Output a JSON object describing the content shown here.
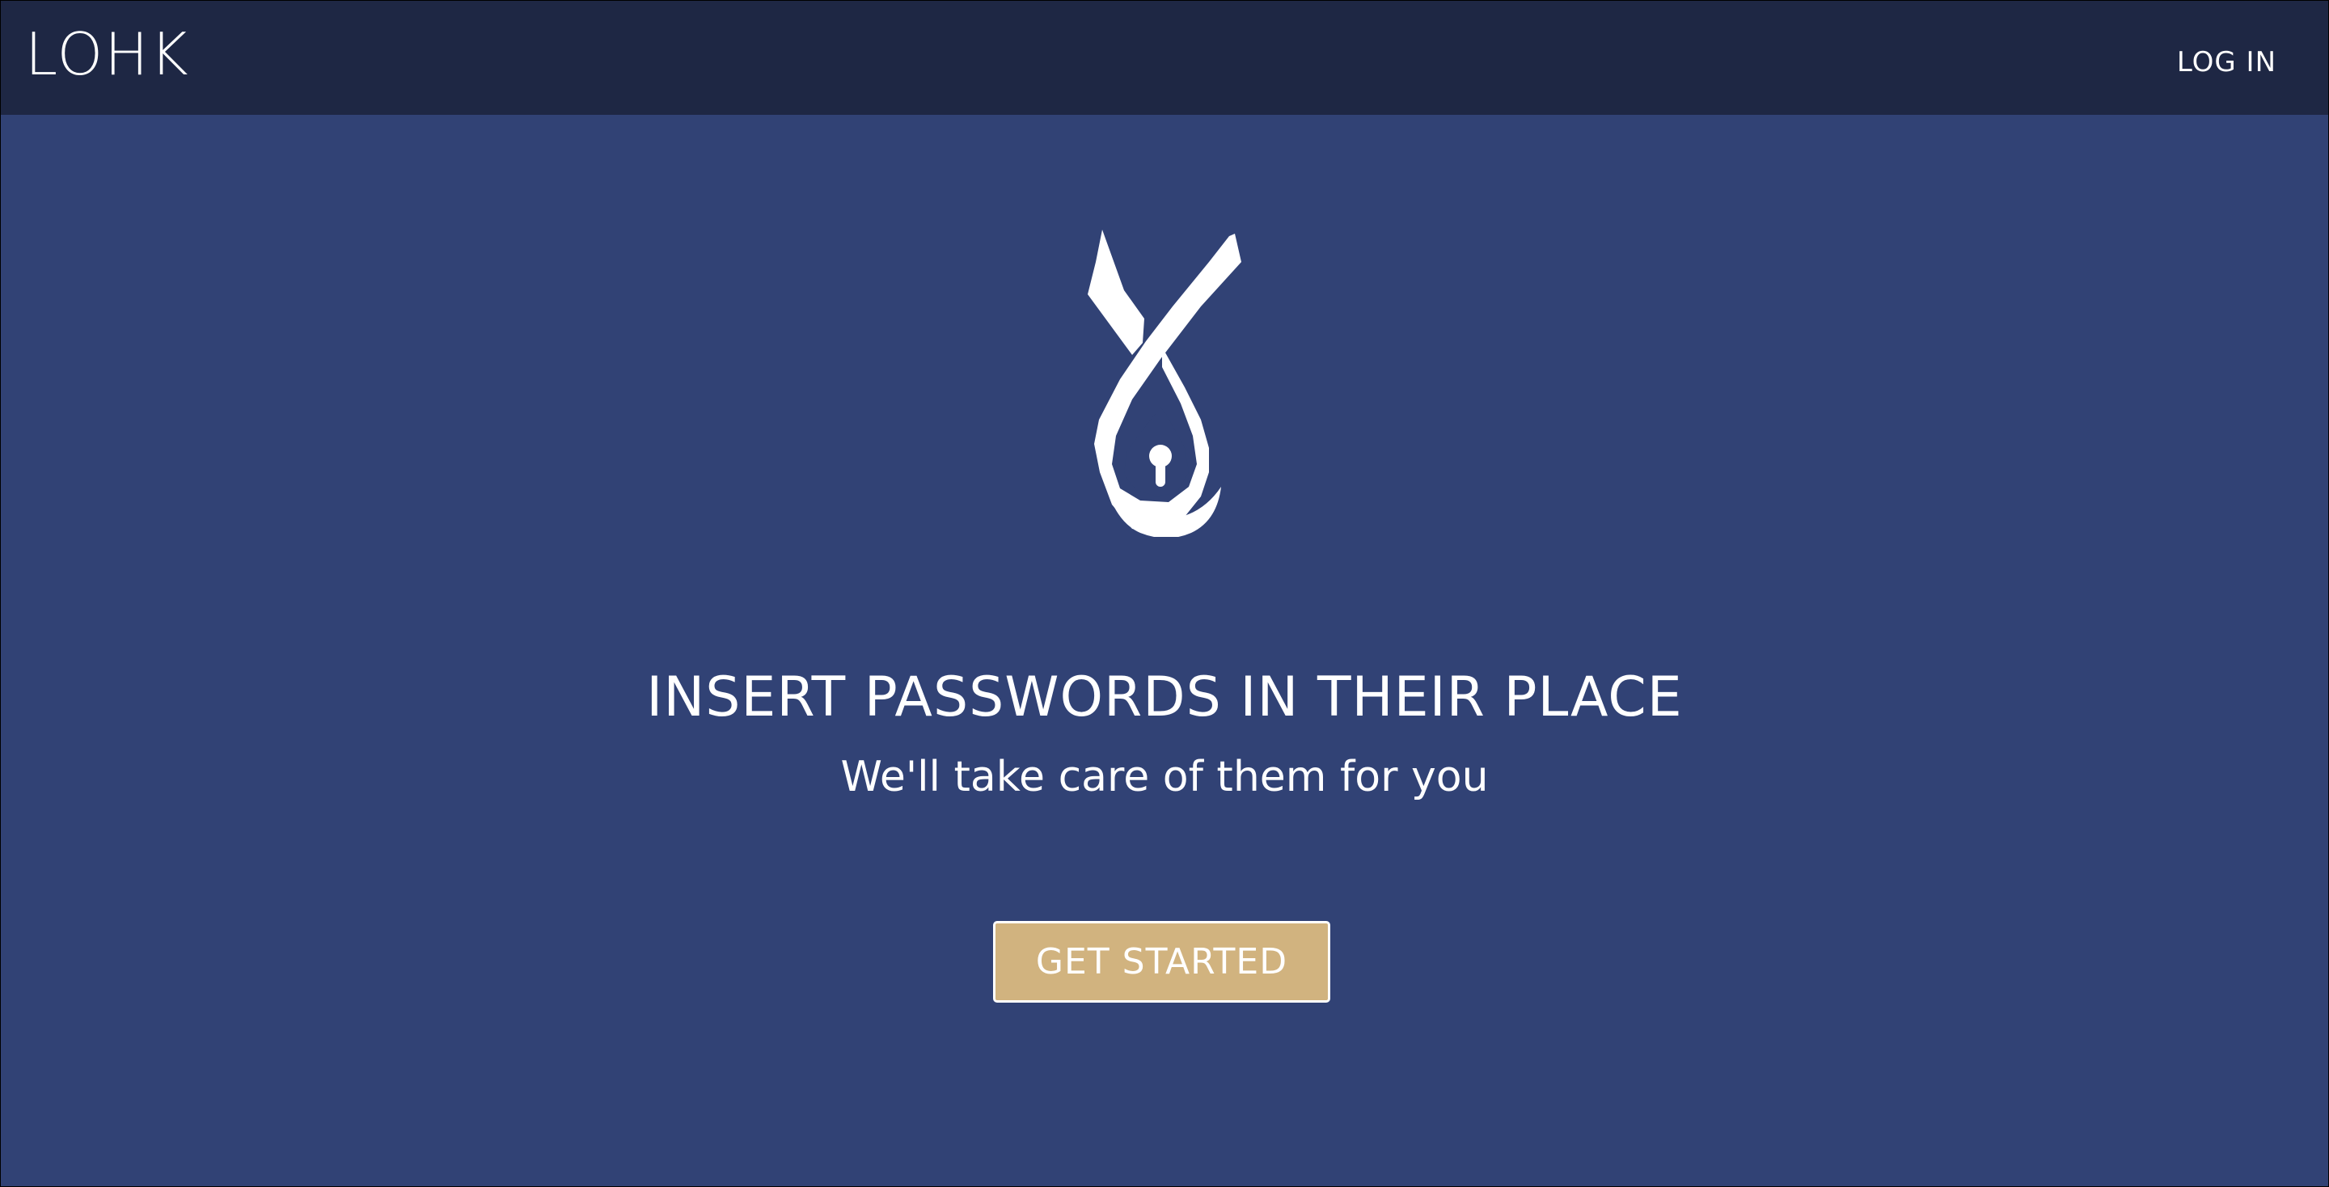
{
  "header": {
    "brand": "LOHK",
    "login_label": "LOG IN"
  },
  "hero": {
    "logo_icon": "ribbon-keyhole-icon",
    "headline": "INSERT PASSWORDS IN THEIR PLACE",
    "subheadline": "We'll take care of them for you",
    "cta_label": "GET STARTED"
  },
  "colors": {
    "header_bg": "#1e2744",
    "page_bg": "#314275",
    "cta_bg": "#d1b37f",
    "text": "#ffffff"
  }
}
